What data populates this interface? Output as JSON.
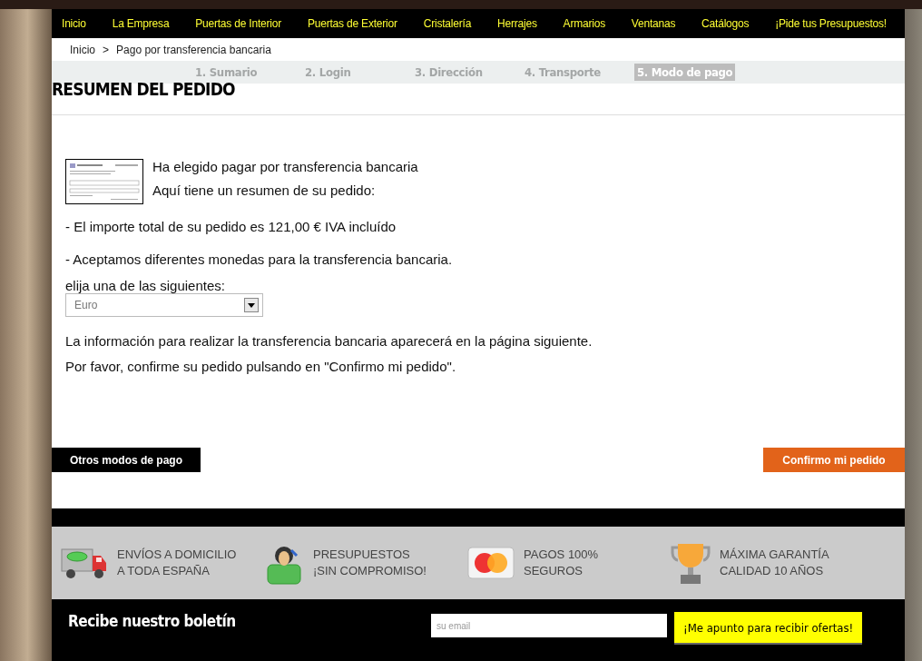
{
  "nav": [
    {
      "label": "Inicio"
    },
    {
      "label": "La Empresa"
    },
    {
      "label": "Puertas de Interior"
    },
    {
      "label": "Puertas de Exterior"
    },
    {
      "label": "Cristalería"
    },
    {
      "label": "Herrajes"
    },
    {
      "label": "Armarios"
    },
    {
      "label": "Ventanas"
    },
    {
      "label": "Catálogos"
    },
    {
      "label": "¡Pide tus Presupuestos!"
    }
  ],
  "breadcrumb": {
    "home": "Inicio",
    "separator": ">",
    "current": "Pago por transferencia bancaria"
  },
  "steps": [
    {
      "label": "1. Sumario",
      "selected": false
    },
    {
      "label": "2. Login",
      "selected": false
    },
    {
      "label": "3. Dirección",
      "selected": false
    },
    {
      "label": "4. Transporte",
      "selected": false
    },
    {
      "label": "5. Modo de pago",
      "selected": true
    }
  ],
  "title": "RESUMEN DEL PEDIDO",
  "intro": [
    "Ha elegido pagar por transferencia bancaria",
    "Aquí tiene un resumen de su pedido:"
  ],
  "lines": [
    "- El importe total de su pedido es 121,00 € IVA incluído",
    "- Aceptamos diferentes monedas para la transferencia bancaria."
  ],
  "currency": {
    "label": "elija una de las siguientes:",
    "value": "Euro"
  },
  "notes": [
    "La información para realizar la transferencia bancaria aparecerá en la página siguiente.",
    "Por favor, confirme su pedido pulsando en \"Confirmo mi pedido\"."
  ],
  "buttons": {
    "back": "Otros modos de pago",
    "confirm": "Confirmo mi pedido"
  },
  "features": [
    {
      "kind": "truck",
      "lines": [
        "ENVÍOS A DOMICILIO",
        "A TODA ESPAÑA"
      ]
    },
    {
      "kind": "person",
      "lines": [
        "PRESUPUESTOS",
        "¡SIN COMPROMISO!"
      ]
    },
    {
      "kind": "card",
      "lines": [
        "PAGOS 100%",
        "SEGUROS"
      ]
    },
    {
      "kind": "trophy",
      "lines": [
        "MÁXIMA GARANTÍA",
        "CALIDAD 10 AÑOS"
      ]
    }
  ],
  "newsletter": {
    "title": "Recibe nuestro boletín",
    "placeholder": "su email",
    "button": "¡Me apunto para recibir ofertas!"
  }
}
